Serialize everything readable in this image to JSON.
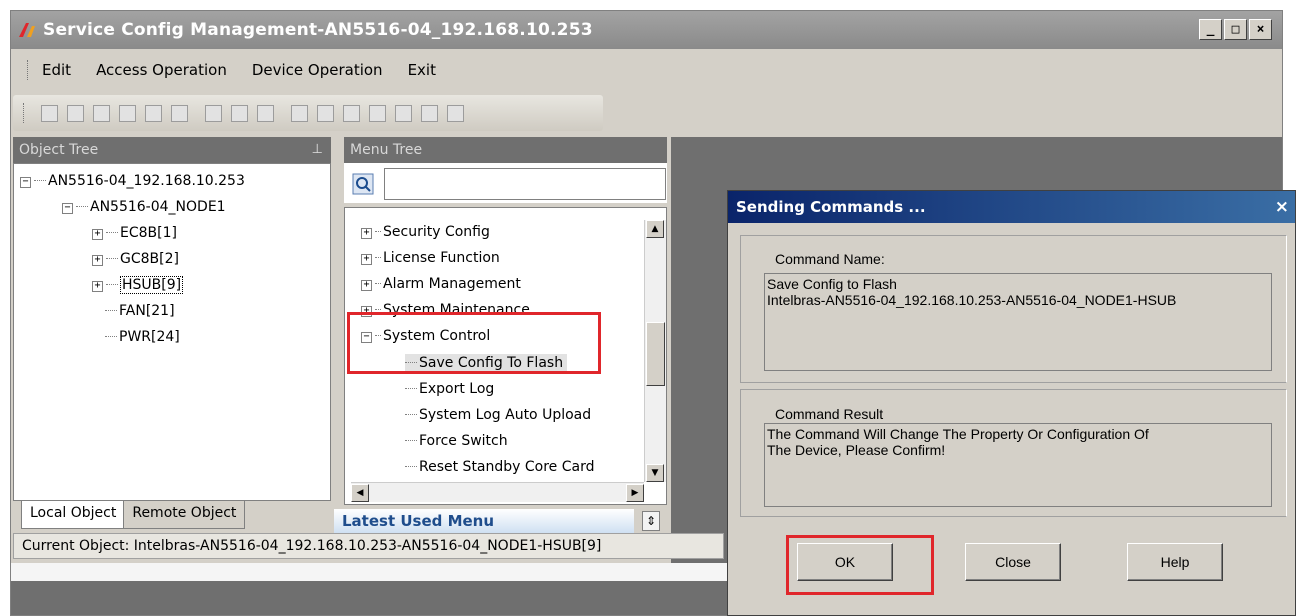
{
  "window": {
    "title": "Service Config Management-AN5516-04_192.168.10.253",
    "buttons": [
      "minimize-icon",
      "maximize-icon",
      "close-icon"
    ]
  },
  "menubar": {
    "items": [
      "Edit",
      "Access Operation",
      "Device Operation",
      "Exit"
    ]
  },
  "toolbar": {
    "icon_count": 16
  },
  "object_tree": {
    "header": "Object Tree",
    "root": "AN5516-04_192.168.10.253",
    "node": "AN5516-04_NODE1",
    "cards": [
      "EC8B[1]",
      "GC8B[2]",
      "HSUB[9]",
      "FAN[21]",
      "PWR[24]"
    ],
    "selected": "HSUB[9]"
  },
  "tabs": [
    "Local Object",
    "Remote Object"
  ],
  "menu_tree": {
    "header": "Menu Tree",
    "search_value": "",
    "items": [
      "Security Config",
      "License Function",
      "Alarm Management",
      "System Maintenance",
      "System Control"
    ],
    "children": [
      "Save Config To Flash",
      "Export Log",
      "System Log Auto Upload",
      "Force Switch",
      "Reset Standby Core Card"
    ],
    "selected": "Save Config To Flash"
  },
  "latest_used_menu": "Latest Used Menu",
  "status": "Current Object: Intelbras-AN5516-04_192.168.10.253-AN5516-04_NODE1-HSUB[9]",
  "dialog": {
    "title": "Sending Commands ...",
    "command_name_label": "Command Name:",
    "command_name_line1": "Save Config  to Flash",
    "command_name_line2": "Intelbras-AN5516-04_192.168.10.253-AN5516-04_NODE1-HSUB",
    "command_result_label": "Command Result",
    "command_result_line1": "The Command Will Change The Property Or Configuration Of",
    "command_result_line2": "The Device, Please Confirm!",
    "ok_label": "OK",
    "close_label": "Close",
    "help_label": "Help"
  },
  "colors": {
    "highlight": "#e0262b",
    "dialog_title": "#0a246a",
    "panel_header": "#6f6f6f"
  }
}
